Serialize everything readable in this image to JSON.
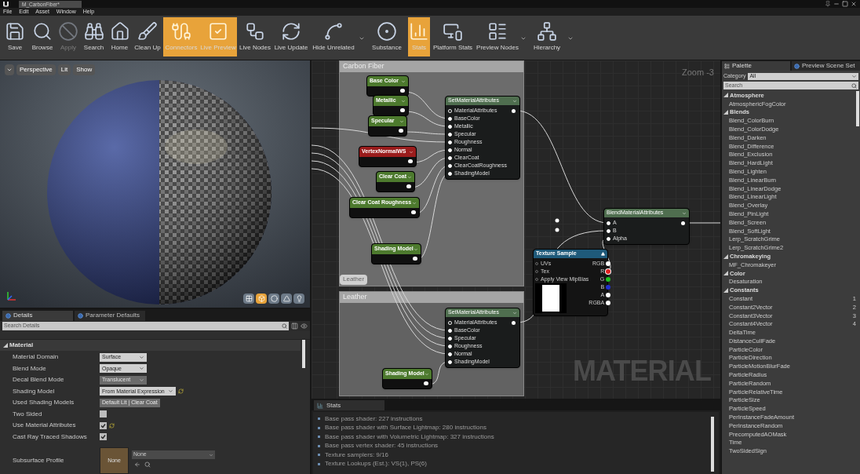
{
  "window": {
    "tab": "M_CarbonFiber*"
  },
  "menu": [
    "File",
    "Edit",
    "Asset",
    "Window",
    "Help"
  ],
  "toolbar": [
    {
      "label": "Save",
      "selected": false,
      "disabled": false,
      "dropdown": false
    },
    {
      "label": "Browse",
      "selected": false,
      "disabled": false,
      "dropdown": false
    },
    {
      "label": "Apply",
      "selected": false,
      "disabled": true,
      "dropdown": false
    },
    {
      "label": "Search",
      "selected": false,
      "disabled": false,
      "dropdown": false
    },
    {
      "label": "Home",
      "selected": false,
      "disabled": false,
      "dropdown": false
    },
    {
      "label": "Clean Up",
      "selected": false,
      "disabled": false,
      "dropdown": false
    },
    {
      "label": "Connectors",
      "selected": true,
      "disabled": false,
      "dropdown": false
    },
    {
      "label": "Live Preview",
      "selected": true,
      "disabled": false,
      "dropdown": false
    },
    {
      "label": "Live Nodes",
      "selected": false,
      "disabled": false,
      "dropdown": false
    },
    {
      "label": "Live Update",
      "selected": false,
      "disabled": false,
      "dropdown": false
    },
    {
      "label": "Hide Unrelated",
      "selected": false,
      "disabled": false,
      "dropdown": true
    },
    {
      "label": "Substance",
      "selected": false,
      "disabled": false,
      "dropdown": false
    },
    {
      "label": "Stats",
      "selected": true,
      "disabled": false,
      "dropdown": false
    },
    {
      "label": "Platform Stats",
      "selected": false,
      "disabled": false,
      "dropdown": false
    },
    {
      "label": "Preview Nodes",
      "selected": false,
      "disabled": false,
      "dropdown": true
    },
    {
      "label": "Hierarchy",
      "selected": false,
      "disabled": false,
      "dropdown": true
    }
  ],
  "viewport": {
    "view_mode": "Perspective",
    "lighting": "Lit",
    "show": "Show",
    "toggles": [
      {
        "selected": false
      },
      {
        "selected": true
      },
      {
        "selected": false
      },
      {
        "selected": false
      },
      {
        "selected": false
      }
    ]
  },
  "details": {
    "tabs": [
      {
        "label": "Details",
        "selected": true
      },
      {
        "label": "Parameter Defaults",
        "selected": false
      }
    ],
    "search": {
      "placeholder": "Search Details"
    },
    "section": "Material",
    "rows": [
      {
        "label": "Material Domain",
        "kind": "dropdown",
        "value": "Surface",
        "disabled": false,
        "reset": false
      },
      {
        "label": "Blend Mode",
        "kind": "dropdown",
        "value": "Opaque",
        "disabled": false,
        "reset": false
      },
      {
        "label": "Decal Blend Mode",
        "kind": "dropdown",
        "value": "Translucent",
        "disabled": true,
        "reset": false
      },
      {
        "label": "Shading Model",
        "kind": "dropdown",
        "value": "From Material Expression",
        "disabled": false,
        "reset": true
      },
      {
        "label": "Used Shading Models",
        "kind": "tag",
        "value": "Default Lit | Clear Coat",
        "disabled": true,
        "reset": false
      },
      {
        "label": "Two Sided",
        "kind": "checkbox",
        "checked": false,
        "disabled": false,
        "reset": false
      },
      {
        "label": "Use Material Attributes",
        "kind": "checkbox",
        "checked": true,
        "disabled": false,
        "reset": true
      },
      {
        "label": "Cast Ray Traced Shadows",
        "kind": "checkbox",
        "checked": true,
        "disabled": false,
        "reset": false
      },
      {
        "label": "Subsurface Profile",
        "kind": "asset",
        "thumbnail": "None",
        "value": "None",
        "disabled": true,
        "reset": false
      }
    ]
  },
  "graph": {
    "zoom": "Zoom -3",
    "watermark": "MATERIAL",
    "comments": [
      {
        "title": "Carbon Fiber"
      },
      {
        "title": "Leather"
      }
    ],
    "leather_label": "Leather",
    "nodes": [
      {
        "kind": "param",
        "title": "Base Color",
        "color": "#4d7a2e"
      },
      {
        "kind": "param",
        "title": "Metallic",
        "color": "#4d7a2e"
      },
      {
        "kind": "param",
        "title": "Specular",
        "color": "#4d7a2e"
      },
      {
        "kind": "param",
        "title": "VertexNormalWS",
        "color": "#9a1c1c"
      },
      {
        "kind": "param",
        "title": "Clear Coat",
        "color": "#4d7a2e"
      },
      {
        "kind": "param",
        "title": "Clear Coat Roughness",
        "color": "#4d7a2e"
      },
      {
        "kind": "param",
        "title": "Shading Model",
        "color": "#4d7a2e"
      },
      {
        "kind": "attributes",
        "title": "SetMaterialAttributes",
        "color": "#4f6e4f",
        "inputs": [
          {
            "label": "MaterialAttributes",
            "connected": false
          },
          {
            "label": "BaseColor",
            "connected": true
          },
          {
            "label": "Metallic",
            "connected": true
          },
          {
            "label": "Specular",
            "connected": true
          },
          {
            "label": "Roughness",
            "connected": true
          },
          {
            "label": "Normal",
            "connected": true
          },
          {
            "label": "ClearCoat",
            "connected": true
          },
          {
            "label": "ClearCoatRoughness",
            "connected": true
          },
          {
            "label": "ShadingModel",
            "connected": true
          }
        ]
      },
      {
        "kind": "attributes",
        "title": "SetMaterialAttributes",
        "color": "#4f6e4f",
        "inputs": [
          {
            "label": "MaterialAttributes",
            "connected": false
          },
          {
            "label": "BaseColor",
            "connected": true
          },
          {
            "label": "Specular",
            "connected": true
          },
          {
            "label": "Roughness",
            "connected": true
          },
          {
            "label": "Normal",
            "connected": true
          },
          {
            "label": "ShadingModel",
            "connected": true
          }
        ]
      },
      {
        "kind": "param",
        "title": "Shading Model",
        "color": "#4d7a2e"
      },
      {
        "kind": "attributes",
        "title": "BlendMaterialAttributes",
        "color": "#4f6e4f",
        "inputs": [
          {
            "label": "A",
            "connected": true
          },
          {
            "label": "B",
            "connected": true
          },
          {
            "label": "Alpha",
            "connected": true
          }
        ]
      },
      {
        "kind": "texture",
        "title": "Texture Sample",
        "color": "#1f5a7a",
        "inputs": [
          {
            "label": "UVs",
            "connected": false
          },
          {
            "label": "Tex",
            "connected": false
          },
          {
            "label": "Apply View MipBias",
            "connected": false
          }
        ],
        "outputs": [
          {
            "label": "RGB",
            "color": "#ffffff",
            "connected": false
          },
          {
            "label": "R",
            "color": "#e02020",
            "connected": true
          },
          {
            "label": "G",
            "color": "#20c020",
            "connected": false
          },
          {
            "label": "B",
            "color": "#2030d0",
            "connected": false
          },
          {
            "label": "A",
            "color": "#ffffff",
            "connected": false
          },
          {
            "label": "RGBA",
            "color": "#ffffff",
            "connected": false
          }
        ]
      }
    ]
  },
  "stats": {
    "tab": "Stats",
    "lines": [
      "Base pass shader: 227 instructions",
      "Base pass shader with Surface Lightmap: 280 instructions",
      "Base pass shader with Volumetric Lightmap: 327 instructions",
      "Base pass vertex shader: 45 instructions",
      "Texture samplers: 9/16",
      "Texture Lookups (Est.): VS(1), PS(6)"
    ]
  },
  "palette": {
    "tabs": [
      {
        "label": "Palette",
        "selected": true
      },
      {
        "label": "Preview Scene Set",
        "selected": false
      }
    ],
    "category_label": "Category",
    "category": "All",
    "search": {
      "placeholder": "Search"
    },
    "groups": [
      {
        "name": "Atmosphere",
        "expanded": true,
        "children": [
          {
            "name": "AtmosphericFogColor"
          }
        ]
      },
      {
        "name": "Blends",
        "expanded": true,
        "children": [
          {
            "name": "Blend_ColorBurn"
          },
          {
            "name": "Blend_ColorDodge"
          },
          {
            "name": "Blend_Darken"
          },
          {
            "name": "Blend_Difference"
          },
          {
            "name": "Blend_Exclusion"
          },
          {
            "name": "Blend_HardLight"
          },
          {
            "name": "Blend_Lighten"
          },
          {
            "name": "Blend_LinearBurn"
          },
          {
            "name": "Blend_LinearDodge"
          },
          {
            "name": "Blend_LinearLight"
          },
          {
            "name": "Blend_Overlay"
          },
          {
            "name": "Blend_PinLight"
          },
          {
            "name": "Blend_Screen"
          },
          {
            "name": "Blend_SoftLight"
          },
          {
            "name": "Lerp_ScratchGrime"
          },
          {
            "name": "Lerp_ScratchGrime2"
          }
        ]
      },
      {
        "name": "Chromakeying",
        "expanded": true,
        "children": [
          {
            "name": "MF_Chromakeyer"
          }
        ]
      },
      {
        "name": "Color",
        "expanded": true,
        "children": [
          {
            "name": "Desaturation"
          }
        ]
      },
      {
        "name": "Constants",
        "expanded": true,
        "children": [
          {
            "name": "Constant",
            "key": "1"
          },
          {
            "name": "Constant2Vector",
            "key": "2"
          },
          {
            "name": "Constant3Vector",
            "key": "3"
          },
          {
            "name": "Constant4Vector",
            "key": "4"
          },
          {
            "name": "DeltaTime"
          },
          {
            "name": "DistanceCullFade"
          },
          {
            "name": "ParticleColor"
          },
          {
            "name": "ParticleDirection"
          },
          {
            "name": "ParticleMotionBlurFade"
          },
          {
            "name": "ParticleRadius"
          },
          {
            "name": "ParticleRandom"
          },
          {
            "name": "ParticleRelativeTime"
          },
          {
            "name": "ParticleSize"
          },
          {
            "name": "ParticleSpeed"
          },
          {
            "name": "PerInstanceFadeAmount"
          },
          {
            "name": "PerInstanceRandom"
          },
          {
            "name": "PrecomputedAOMask"
          },
          {
            "name": "Time"
          },
          {
            "name": "TwoSidedSign"
          }
        ]
      }
    ]
  }
}
